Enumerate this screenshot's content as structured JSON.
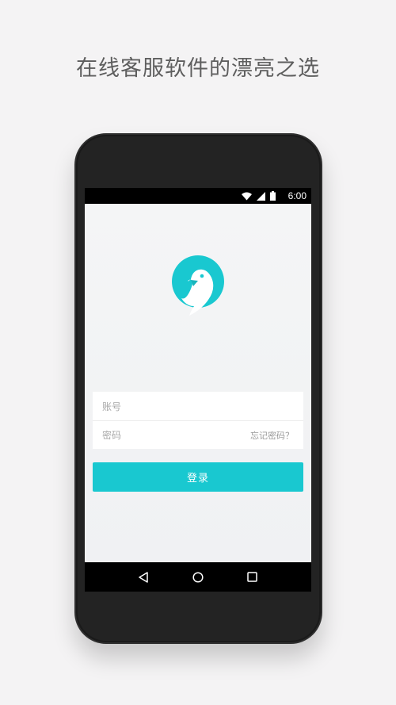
{
  "headline": "在线客服软件的漂亮之选",
  "status_bar": {
    "time": "6:00",
    "icons": [
      "wifi-icon",
      "signal-icon",
      "battery-icon"
    ]
  },
  "logo": {
    "icon": "parrot-speech-bubble-icon",
    "color": "#19c8d0"
  },
  "login_form": {
    "account_placeholder": "账号",
    "password_placeholder": "密码",
    "forgot_password_label": "忘记密码？",
    "login_button_label": "登录",
    "accent_color": "#19c8d0"
  },
  "nav_bar": {
    "buttons": [
      "back-icon",
      "home-icon",
      "recents-icon"
    ]
  }
}
